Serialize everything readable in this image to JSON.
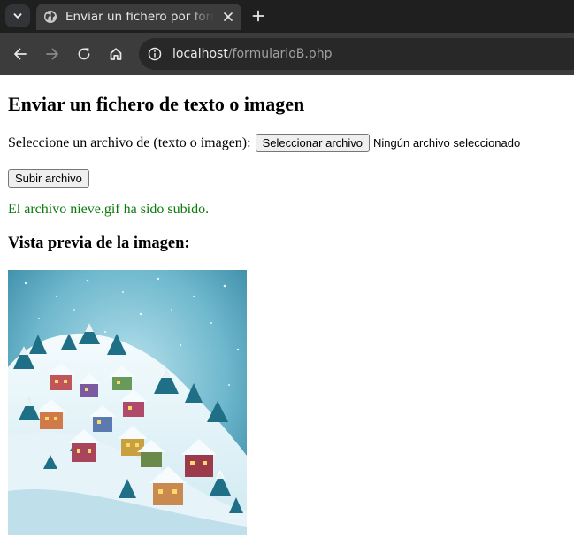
{
  "browser": {
    "tab_title": "Enviar un fichero por formulario",
    "url_host": "localhost",
    "url_path": "/formularioB.php"
  },
  "page": {
    "heading": "Enviar un fichero de texto o imagen",
    "file_label": "Seleccione un archivo de (texto o imagen):",
    "file_button": "Seleccionar archivo",
    "file_status": "Ningún archivo seleccionado",
    "submit_button": "Subir archivo",
    "success_message": "El archivo nieve.gif ha sido subido.",
    "preview_heading": "Vista previa de la imagen:",
    "success_color": "#0a7a0a"
  },
  "icons": {
    "tab_list": "chevron-down-icon",
    "favicon": "globe-icon",
    "close": "close-icon",
    "new_tab": "plus-icon",
    "back": "arrow-left-icon",
    "forward": "arrow-right-icon",
    "reload": "reload-icon",
    "home": "home-icon",
    "site_info": "info-icon"
  }
}
